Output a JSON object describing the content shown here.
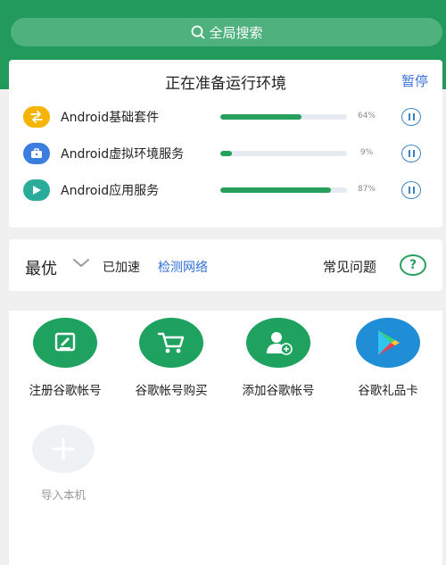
{
  "search": {
    "label": "全局搜索",
    "icon": "search-icon"
  },
  "environment": {
    "title": "正在准备运行环境",
    "pause_label": "暂停",
    "items": [
      {
        "label": "Android基础套件",
        "percent_text": "64%",
        "progress": 64,
        "icon": "swap-arrows-icon",
        "icon_color": "#f4b400"
      },
      {
        "label": "Android虚拟环境服务",
        "percent_text": "9%",
        "progress": 9,
        "icon": "briefcase-icon",
        "icon_color": "#3c7de0"
      },
      {
        "label": "Android应用服务",
        "percent_text": "87%",
        "progress": 87,
        "icon": "play-triangle-icon",
        "icon_color": "#2bab9a"
      }
    ]
  },
  "network": {
    "mode": "最优",
    "status": "已加速",
    "detect_link": "检测网络",
    "faq": "常见问题",
    "help_symbol": "?"
  },
  "tools": [
    {
      "label": "注册谷歌帐号",
      "icon": "edit-icon"
    },
    {
      "label": "谷歌帐号购买",
      "icon": "shopping-cart-icon"
    },
    {
      "label": "添加谷歌帐号",
      "icon": "add-user-icon"
    },
    {
      "label": "谷歌礼品卡",
      "icon": "google-play-icon"
    }
  ],
  "import": {
    "label": "导入本机",
    "icon": "plus-icon"
  },
  "colors": {
    "brand_green": "#229a5b",
    "progress_green": "#27a05e",
    "link_blue": "#2d6fd6"
  }
}
